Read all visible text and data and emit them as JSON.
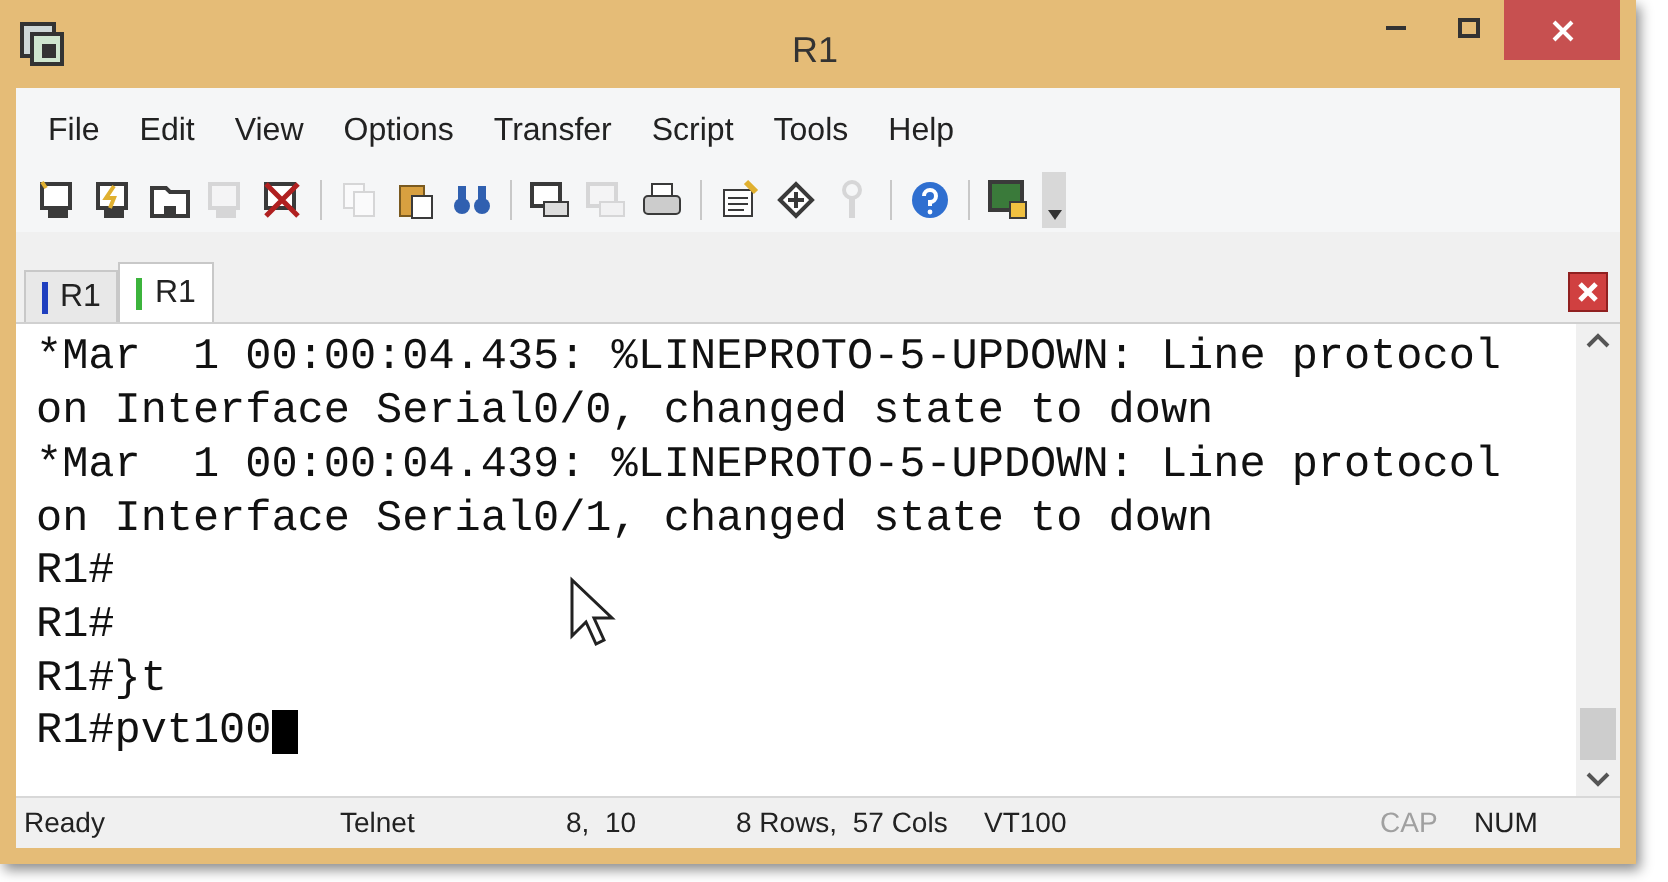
{
  "window": {
    "title": "R1"
  },
  "menu": [
    "File",
    "Edit",
    "View",
    "Options",
    "Transfer",
    "Script",
    "Tools",
    "Help"
  ],
  "toolbar": [
    {
      "kind": "icon",
      "disabled": false
    },
    {
      "kind": "icon",
      "disabled": false
    },
    {
      "kind": "icon",
      "disabled": false
    },
    {
      "kind": "icon",
      "disabled": true
    },
    {
      "kind": "icon",
      "disabled": false
    },
    {
      "kind": "separator"
    },
    {
      "kind": "icon",
      "disabled": true
    },
    {
      "kind": "icon",
      "disabled": false
    },
    {
      "kind": "icon",
      "disabled": false
    },
    {
      "kind": "separator"
    },
    {
      "kind": "icon",
      "disabled": false
    },
    {
      "kind": "icon",
      "disabled": true
    },
    {
      "kind": "icon",
      "disabled": false
    },
    {
      "kind": "separator"
    },
    {
      "kind": "icon",
      "disabled": false
    },
    {
      "kind": "icon",
      "disabled": false
    },
    {
      "kind": "icon",
      "disabled": true
    },
    {
      "kind": "separator"
    },
    {
      "kind": "icon",
      "disabled": false
    },
    {
      "kind": "separator"
    },
    {
      "kind": "icon",
      "disabled": false
    }
  ],
  "tabs": [
    {
      "label": "R1",
      "selected": false,
      "color": "#1f3fbf"
    },
    {
      "label": "R1",
      "selected": true,
      "color": "#3cb43c"
    }
  ],
  "terminal": {
    "lines": [
      "*Mar  1 00:00:04.435: %LINEPROTO-5-UPDOWN: Line protocol",
      "on Interface Serial0/0, changed state to down",
      "*Mar  1 00:00:04.439: %LINEPROTO-5-UPDOWN: Line protocol",
      "on Interface Serial0/1, changed state to down",
      "R1#",
      "R1#",
      "R1#}t",
      "R1#pvt100"
    ],
    "cursor": true
  },
  "status_bar": [
    {
      "text": "Ready",
      "active": true
    },
    {
      "text": "Telnet",
      "active": true
    },
    {
      "text": "8,  10",
      "active": true
    },
    {
      "text": "8 Rows,  57 Cols",
      "active": true
    },
    {
      "text": "VT100",
      "active": true
    },
    {
      "text": "CAP",
      "active": false
    },
    {
      "text": "NUM",
      "active": true
    }
  ]
}
